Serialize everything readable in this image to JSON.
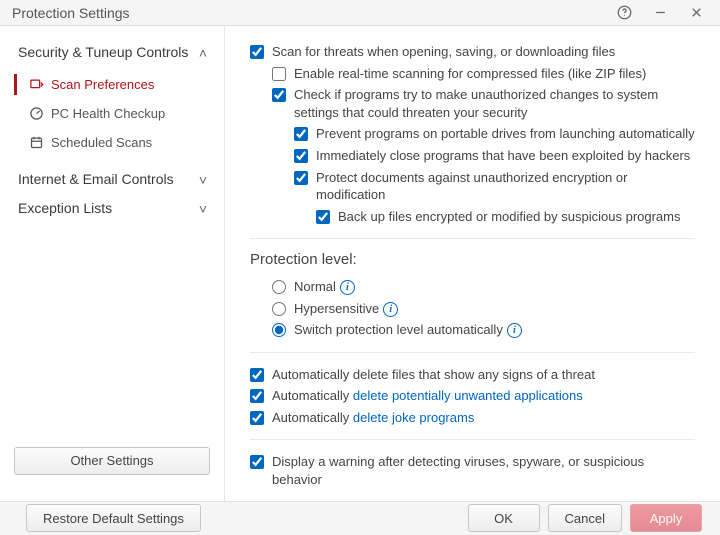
{
  "title": "Protection Settings",
  "sidebar": {
    "sections": [
      {
        "title": "Security & Tuneup Controls",
        "expanded": true,
        "items": [
          {
            "label": "Scan Preferences",
            "selected": true
          },
          {
            "label": "PC Health Checkup",
            "selected": false
          },
          {
            "label": "Scheduled Scans",
            "selected": false
          }
        ]
      },
      {
        "title": "Internet & Email Controls",
        "expanded": false,
        "items": []
      },
      {
        "title": "Exception Lists",
        "expanded": false,
        "items": []
      }
    ],
    "other_settings_label": "Other Settings"
  },
  "content": {
    "checks": {
      "scan_open_save_download": {
        "label": "Scan for threats when opening, saving, or downloading files",
        "checked": true
      },
      "realtime_compressed": {
        "label": "Enable real-time scanning for compressed files (like ZIP files)",
        "checked": false
      },
      "check_unauthorized": {
        "label": "Check if programs try to make unauthorized changes to system settings that could threaten your security",
        "checked": true
      },
      "prevent_portable": {
        "label": "Prevent programs on portable drives from launching automatically",
        "checked": true
      },
      "close_exploited": {
        "label": "Immediately close programs that have been exploited by hackers",
        "checked": true
      },
      "protect_docs": {
        "label": "Protect documents against unauthorized encryption or modification",
        "checked": true
      },
      "backup_encrypted": {
        "label": "Back up files encrypted or modified by suspicious programs",
        "checked": true
      },
      "auto_delete_threat": {
        "label": "Automatically delete files that show any signs of a threat",
        "checked": true
      },
      "auto_delete_pua_prefix": "Automatically ",
      "auto_delete_pua_link": "delete potentially unwanted applications",
      "auto_delete_pua_checked": true,
      "auto_delete_joke_prefix": "Automatically ",
      "auto_delete_joke_link": "delete joke programs",
      "auto_delete_joke_checked": true,
      "display_warning": {
        "label": "Display a warning after detecting viruses, spyware, or suspicious behavior",
        "checked": true
      }
    },
    "protection_level": {
      "title": "Protection level:",
      "options": [
        {
          "label": "Normal",
          "selected": false,
          "info": true
        },
        {
          "label": "Hypersensitive",
          "selected": false,
          "info": true
        },
        {
          "label": "Switch protection level automatically",
          "selected": true,
          "info": true
        }
      ]
    }
  },
  "footer": {
    "restore_label": "Restore Default Settings",
    "ok_label": "OK",
    "cancel_label": "Cancel",
    "apply_label": "Apply"
  }
}
